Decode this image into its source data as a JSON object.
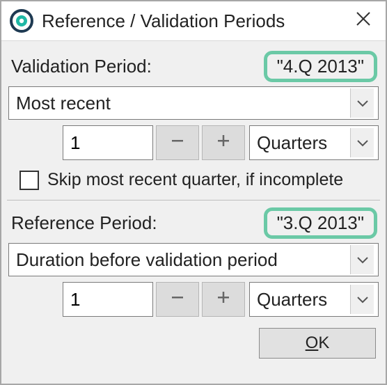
{
  "dialog": {
    "title": "Reference / Validation Periods",
    "validation": {
      "label": "Validation Period:",
      "badge": "\"4.Q 2013\"",
      "mode": "Most recent",
      "count": "1",
      "unit": "Quarters",
      "skip_label": "Skip most recent quarter, if incomplete",
      "skip_checked": false
    },
    "reference": {
      "label": "Reference Period:",
      "badge": "\"3.Q 2013\"",
      "mode": "Duration before validation period",
      "count": "1",
      "unit": "Quarters"
    },
    "ok_label": "OK"
  }
}
